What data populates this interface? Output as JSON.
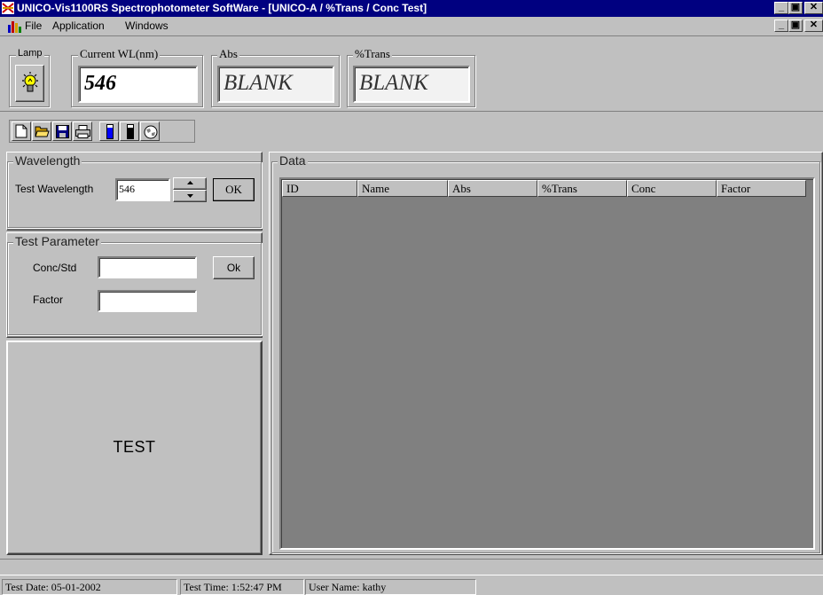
{
  "window": {
    "title": "UNICO-Vis1100RS Spectrophotometer SoftWare - [UNICO-A / %Trans / Conc Test]"
  },
  "menu": {
    "items": [
      "File",
      "Application",
      "Windows"
    ]
  },
  "indicators": {
    "lamp_label": "Lamp",
    "wl_label": "Current WL(nm)",
    "wl_value": "546",
    "abs_label": "Abs",
    "abs_value": "BLANK",
    "trans_label": "%Trans",
    "trans_value": "BLANK"
  },
  "toolbar": {
    "icons": [
      "new-file-icon",
      "open-folder-icon",
      "save-icon",
      "print-icon",
      "blue-cuvette-icon",
      "black-cuvette-icon",
      "globe-icon"
    ]
  },
  "wavelength": {
    "group_label": "Wavelength",
    "field_label": "Test Wavelength",
    "field_value": "546",
    "ok_label": "OK"
  },
  "test_parameter": {
    "group_label": "Test Parameter",
    "conc_label": "Conc/Std",
    "conc_value": "",
    "factor_label": "Factor",
    "factor_value": "",
    "ok_label": "Ok"
  },
  "test_button": {
    "label": "TEST"
  },
  "data": {
    "group_label": "Data",
    "columns": [
      "ID",
      "Name",
      "Abs",
      "%Trans",
      "Conc",
      "Factor"
    ]
  },
  "status": {
    "date": "Test Date:  05-01-2002",
    "time": "Test Time: 1:52:47 PM",
    "user": "User Name: kathy"
  },
  "colors": {
    "title_bar": "#000080",
    "face": "#c0c0c0",
    "grid_background": "#808080"
  }
}
